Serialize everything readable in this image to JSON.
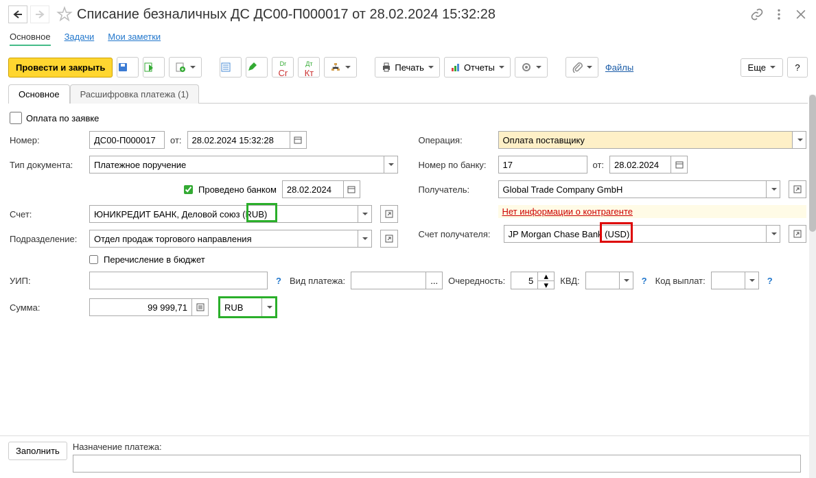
{
  "header": {
    "title": "Списание безналичных ДС ДС00-П000017 от 28.02.2024 15:32:28"
  },
  "navtabs": {
    "main": "Основное",
    "tasks": "Задачи",
    "notes": "Мои заметки"
  },
  "toolbar": {
    "post_close": "Провести и закрыть",
    "print": "Печать",
    "reports": "Отчеты",
    "files": "Файлы",
    "more": "Еще",
    "help": "?"
  },
  "formtabs": {
    "main": "Основное",
    "breakdown": "Расшифровка платежа (1)"
  },
  "form": {
    "pay_by_request_label": "Оплата по заявке",
    "number_label": "Номер:",
    "number": "ДС00-П000017",
    "from_label": "от:",
    "datetime": "28.02.2024 15:32:28",
    "operation_label": "Операция:",
    "operation": "Оплата поставщику",
    "doctype_label": "Тип документа:",
    "doctype": "Платежное поручение",
    "banknum_label": "Номер по банку:",
    "banknum": "17",
    "bankdate": "28.02.2024",
    "processed_label": "Проведено банком",
    "processed_date": "28.02.2024",
    "recipient_label": "Получатель:",
    "recipient": "Global Trade Company GmbH",
    "account_label": "Счет:",
    "account": "ЮНИКРЕДИТ БАНК, Деловой союз (RUB)",
    "no_counterparty_info": "Нет информации о контрагенте",
    "division_label": "Подразделение:",
    "division": "Отдел продаж торгового направления",
    "recipient_account_label": "Счет получателя:",
    "recipient_account": "JP Morgan Chase Bank (USD)",
    "budget_transfer_label": "Перечисление в бюджет",
    "uip_label": "УИП:",
    "payment_type_label": "Вид платежа:",
    "priority_label": "Очередность:",
    "priority": "5",
    "kvd_label": "КВД:",
    "payout_code_label": "Код выплат:",
    "sum_label": "Сумма:",
    "sum": "99 999,71",
    "currency": "RUB"
  },
  "bottom": {
    "fill": "Заполнить",
    "purpose_label": "Назначение платежа:"
  }
}
